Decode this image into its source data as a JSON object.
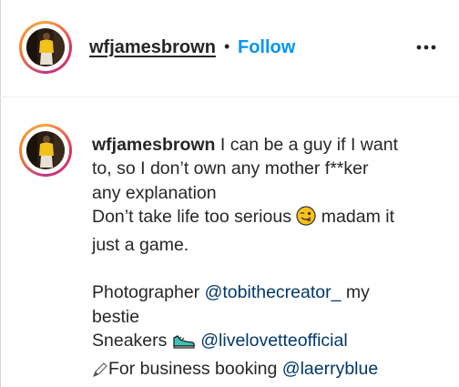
{
  "header": {
    "username": "wfjamesbrown",
    "separator": "•",
    "follow_label": "Follow",
    "more_icon": "more-options-icon"
  },
  "caption": {
    "username": "wfjamesbrown",
    "line1": " I can be a guy if I want",
    "line2": "to, so I don’t own any mother f**ker",
    "line3": "any explanation",
    "line4": "Don’t take life too serious",
    "line4b": " madam it",
    "line5": "just a game.",
    "photographer_label": "Photographer ",
    "photographer_mention": "@tobithecreator_",
    "photographer_tail": " my",
    "line7": "bestie",
    "sneakers_label": "Sneakers ",
    "sneakers_mention": "@livelovetteofficial",
    "booking_label": "For business booking ",
    "booking_mention": "@laerryblue",
    "emojis": [
      "winking-face-with-tongue-emoji",
      "sneaker-emoji",
      "pen-emoji"
    ]
  },
  "colors": {
    "follow": "#0095f6",
    "mention": "#00376b",
    "text": "#262626"
  }
}
